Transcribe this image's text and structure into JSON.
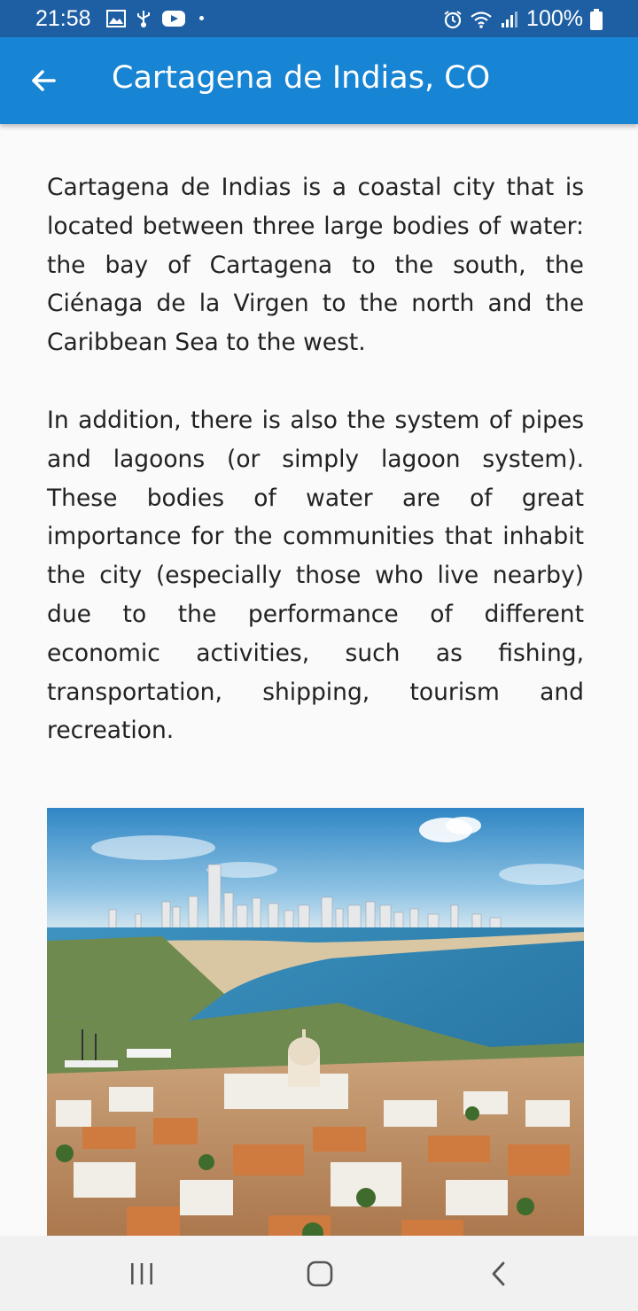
{
  "status_bar": {
    "time": "21:58",
    "battery": "100%",
    "left_icons": [
      "image-icon",
      "usb-icon",
      "youtube-icon"
    ],
    "right_icons": [
      "alarm-icon",
      "wifi-icon",
      "signal-icon",
      "battery-icon"
    ]
  },
  "app_bar": {
    "title": "Cartagena de Indias, CO",
    "back_icon": "arrow-left-icon",
    "color": "#1784d4"
  },
  "content": {
    "paragraphs": [
      "Cartagena de Indias is a coastal city that is located between three large bodies of water: the bay of Cartagena to the south, the Ciénaga de la Virgen to the north and the Caribbean Sea to the west.",
      "In addition, there is also the system of pipes and lagoons (or simply lagoon system). These bodies of water are of great importance for the communities that inhabit the city (especially those who live nearby) due to the performance of different economic activities, such as fishing, transportation, shipping, tourism and recreation."
    ],
    "image_subject": "aerial-city-photo"
  },
  "nav_bar": {
    "buttons": [
      "recent-apps-icon",
      "home-icon",
      "back-icon"
    ]
  }
}
